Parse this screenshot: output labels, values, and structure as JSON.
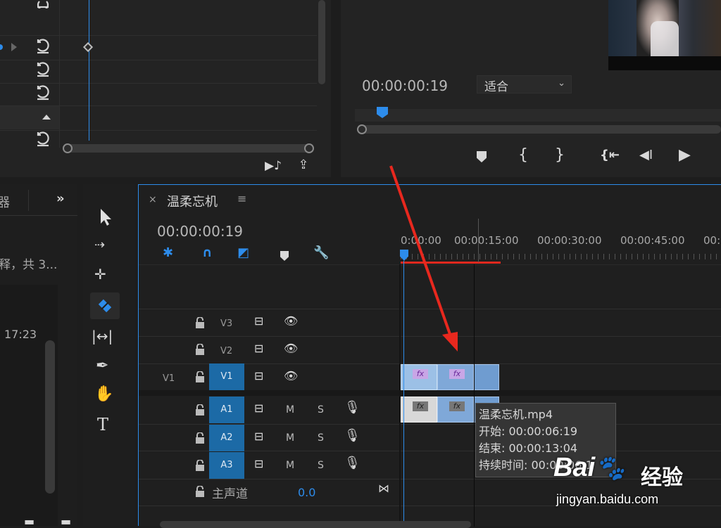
{
  "effect_controls": {
    "reset_icons": [
      "reset-icon",
      "reset-icon",
      "reset-icon",
      "reset-icon"
    ]
  },
  "program_monitor": {
    "timecode": "00:00:00:19",
    "zoom_select": "适合"
  },
  "left_panel": {
    "tab_partial": "器",
    "text_partial": "释，共 3...",
    "time_partial": "17:23"
  },
  "timeline": {
    "tab_title": "温柔忘机",
    "timecode": "00:00:00:19",
    "ruler_labels": [
      "0:00:00",
      "00:00:15:00",
      "00:00:30:00",
      "00:00:45:00",
      "00:0"
    ],
    "tracks": {
      "v3": "V3",
      "v2": "V2",
      "v1_source": "V1",
      "v1": "V1",
      "a1": "A1",
      "a2": "A2",
      "a3": "A3",
      "m": "M",
      "s": "S"
    },
    "master": {
      "label": "主声道",
      "value": "0.0"
    },
    "clip_fx": "fx"
  },
  "tooltip": {
    "name": "温柔忘机.mp4",
    "start": "开始: 00:00:06:19",
    "end": "结束: 00:00:13:04",
    "duration": "持续时间: 00:00:06:1"
  },
  "watermark": {
    "brand": "Bai",
    "brand2": "经验",
    "url": "jingyan.baidu.com"
  }
}
